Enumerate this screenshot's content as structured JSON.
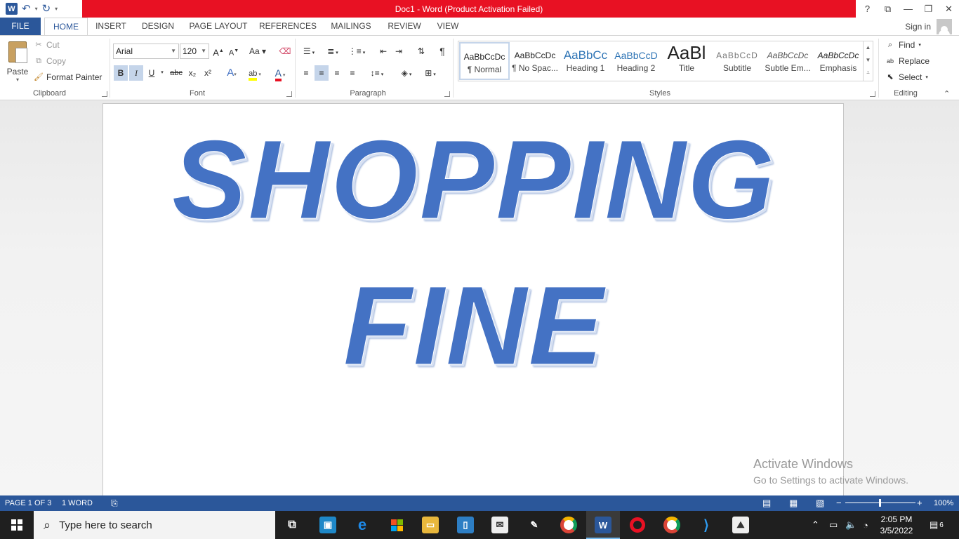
{
  "title": "Doc1 -  Word (Product Activation Failed)",
  "qat": {
    "app_icon": "W"
  },
  "window_controls": {
    "help": "?",
    "restore_ribbon": "⧉",
    "minimize": "—",
    "maximize": "❐",
    "close": "✕"
  },
  "tabs": [
    "FILE",
    "HOME",
    "INSERT",
    "DESIGN",
    "PAGE LAYOUT",
    "REFERENCES",
    "MAILINGS",
    "REVIEW",
    "VIEW"
  ],
  "active_tab": "HOME",
  "sign_in": "Sign in",
  "clipboard": {
    "paste": "Paste",
    "cut": "Cut",
    "copy": "Copy",
    "format_painter": "Format Painter",
    "label": "Clipboard"
  },
  "font": {
    "name": "Arial",
    "size": "120",
    "label": "Font",
    "bold": "B",
    "italic": "I",
    "underline": "U",
    "strike": "abc",
    "subscript": "x₂",
    "superscript": "x²",
    "grow": "A",
    "shrink": "A",
    "case": "Aa"
  },
  "paragraph": {
    "label": "Paragraph",
    "pilcrow": "¶"
  },
  "styles": {
    "label": "Styles",
    "items": [
      {
        "preview": "AaBbCcDc",
        "name": "¶ Normal"
      },
      {
        "preview": "AaBbCcDc",
        "name": "¶ No Spac..."
      },
      {
        "preview": "AaBbCc",
        "name": "Heading 1"
      },
      {
        "preview": "AaBbCcD",
        "name": "Heading 2"
      },
      {
        "preview": "AaBl",
        "name": "Title"
      },
      {
        "preview": "AaBbCcD",
        "name": "Subtitle"
      },
      {
        "preview": "AaBbCcDc",
        "name": "Subtle Em..."
      },
      {
        "preview": "AaBbCcDc",
        "name": "Emphasis"
      }
    ]
  },
  "editing": {
    "find": "Find",
    "replace": "Replace",
    "select": "Select",
    "label": "Editing"
  },
  "document": {
    "line1": "SHOPPING",
    "line2": "FINE"
  },
  "watermark": {
    "line1": "Activate Windows",
    "line2": "Go to Settings to activate Windows."
  },
  "status": {
    "page": "PAGE 1 OF 3",
    "words": "1 WORD",
    "zoom": "100%",
    "zoom_fraction": 0.48
  },
  "taskbar": {
    "search_placeholder": "Type here to search",
    "time": "2:05 PM",
    "date": "3/5/2022",
    "notifications": "6"
  },
  "colors": {
    "word_blue": "#2b579a",
    "title_red": "#e81123",
    "wordart_blue": "#4472c4"
  }
}
